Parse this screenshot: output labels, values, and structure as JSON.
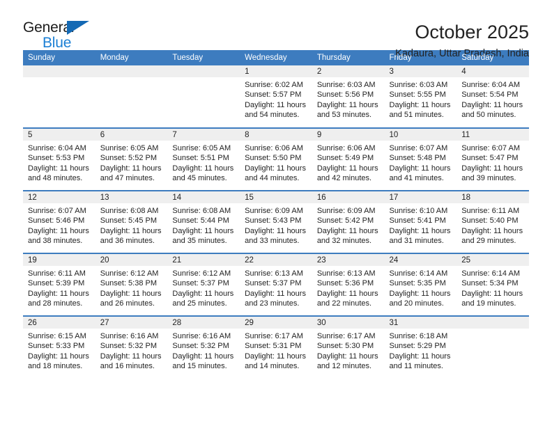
{
  "logo": {
    "word_one": "General",
    "word_two": "Blue",
    "triangle": "blue-triangle",
    "accent_dark": "#1469b4",
    "accent_light": "#1b7fd4"
  },
  "header": {
    "month_title": "October 2025",
    "location": "Kadaura, Uttar Pradesh, India"
  },
  "theme": {
    "header_blue": "#3d7cbf",
    "daynum_gray": "#efefef",
    "text": "#222222"
  },
  "calendar": {
    "weekday_headers": [
      "Sunday",
      "Monday",
      "Tuesday",
      "Wednesday",
      "Thursday",
      "Friday",
      "Saturday"
    ],
    "weeks": [
      [
        {
          "day": "",
          "empty": true
        },
        {
          "day": "",
          "empty": true
        },
        {
          "day": "",
          "empty": true
        },
        {
          "day": "1",
          "sunrise": "Sunrise: 6:02 AM",
          "sunset": "Sunset: 5:57 PM",
          "daylight_line1": "Daylight: 11 hours",
          "daylight_line2": "and 54 minutes."
        },
        {
          "day": "2",
          "sunrise": "Sunrise: 6:03 AM",
          "sunset": "Sunset: 5:56 PM",
          "daylight_line1": "Daylight: 11 hours",
          "daylight_line2": "and 53 minutes."
        },
        {
          "day": "3",
          "sunrise": "Sunrise: 6:03 AM",
          "sunset": "Sunset: 5:55 PM",
          "daylight_line1": "Daylight: 11 hours",
          "daylight_line2": "and 51 minutes."
        },
        {
          "day": "4",
          "sunrise": "Sunrise: 6:04 AM",
          "sunset": "Sunset: 5:54 PM",
          "daylight_line1": "Daylight: 11 hours",
          "daylight_line2": "and 50 minutes."
        }
      ],
      [
        {
          "day": "5",
          "sunrise": "Sunrise: 6:04 AM",
          "sunset": "Sunset: 5:53 PM",
          "daylight_line1": "Daylight: 11 hours",
          "daylight_line2": "and 48 minutes."
        },
        {
          "day": "6",
          "sunrise": "Sunrise: 6:05 AM",
          "sunset": "Sunset: 5:52 PM",
          "daylight_line1": "Daylight: 11 hours",
          "daylight_line2": "and 47 minutes."
        },
        {
          "day": "7",
          "sunrise": "Sunrise: 6:05 AM",
          "sunset": "Sunset: 5:51 PM",
          "daylight_line1": "Daylight: 11 hours",
          "daylight_line2": "and 45 minutes."
        },
        {
          "day": "8",
          "sunrise": "Sunrise: 6:06 AM",
          "sunset": "Sunset: 5:50 PM",
          "daylight_line1": "Daylight: 11 hours",
          "daylight_line2": "and 44 minutes."
        },
        {
          "day": "9",
          "sunrise": "Sunrise: 6:06 AM",
          "sunset": "Sunset: 5:49 PM",
          "daylight_line1": "Daylight: 11 hours",
          "daylight_line2": "and 42 minutes."
        },
        {
          "day": "10",
          "sunrise": "Sunrise: 6:07 AM",
          "sunset": "Sunset: 5:48 PM",
          "daylight_line1": "Daylight: 11 hours",
          "daylight_line2": "and 41 minutes."
        },
        {
          "day": "11",
          "sunrise": "Sunrise: 6:07 AM",
          "sunset": "Sunset: 5:47 PM",
          "daylight_line1": "Daylight: 11 hours",
          "daylight_line2": "and 39 minutes."
        }
      ],
      [
        {
          "day": "12",
          "sunrise": "Sunrise: 6:07 AM",
          "sunset": "Sunset: 5:46 PM",
          "daylight_line1": "Daylight: 11 hours",
          "daylight_line2": "and 38 minutes."
        },
        {
          "day": "13",
          "sunrise": "Sunrise: 6:08 AM",
          "sunset": "Sunset: 5:45 PM",
          "daylight_line1": "Daylight: 11 hours",
          "daylight_line2": "and 36 minutes."
        },
        {
          "day": "14",
          "sunrise": "Sunrise: 6:08 AM",
          "sunset": "Sunset: 5:44 PM",
          "daylight_line1": "Daylight: 11 hours",
          "daylight_line2": "and 35 minutes."
        },
        {
          "day": "15",
          "sunrise": "Sunrise: 6:09 AM",
          "sunset": "Sunset: 5:43 PM",
          "daylight_line1": "Daylight: 11 hours",
          "daylight_line2": "and 33 minutes."
        },
        {
          "day": "16",
          "sunrise": "Sunrise: 6:09 AM",
          "sunset": "Sunset: 5:42 PM",
          "daylight_line1": "Daylight: 11 hours",
          "daylight_line2": "and 32 minutes."
        },
        {
          "day": "17",
          "sunrise": "Sunrise: 6:10 AM",
          "sunset": "Sunset: 5:41 PM",
          "daylight_line1": "Daylight: 11 hours",
          "daylight_line2": "and 31 minutes."
        },
        {
          "day": "18",
          "sunrise": "Sunrise: 6:11 AM",
          "sunset": "Sunset: 5:40 PM",
          "daylight_line1": "Daylight: 11 hours",
          "daylight_line2": "and 29 minutes."
        }
      ],
      [
        {
          "day": "19",
          "sunrise": "Sunrise: 6:11 AM",
          "sunset": "Sunset: 5:39 PM",
          "daylight_line1": "Daylight: 11 hours",
          "daylight_line2": "and 28 minutes."
        },
        {
          "day": "20",
          "sunrise": "Sunrise: 6:12 AM",
          "sunset": "Sunset: 5:38 PM",
          "daylight_line1": "Daylight: 11 hours",
          "daylight_line2": "and 26 minutes."
        },
        {
          "day": "21",
          "sunrise": "Sunrise: 6:12 AM",
          "sunset": "Sunset: 5:37 PM",
          "daylight_line1": "Daylight: 11 hours",
          "daylight_line2": "and 25 minutes."
        },
        {
          "day": "22",
          "sunrise": "Sunrise: 6:13 AM",
          "sunset": "Sunset: 5:37 PM",
          "daylight_line1": "Daylight: 11 hours",
          "daylight_line2": "and 23 minutes."
        },
        {
          "day": "23",
          "sunrise": "Sunrise: 6:13 AM",
          "sunset": "Sunset: 5:36 PM",
          "daylight_line1": "Daylight: 11 hours",
          "daylight_line2": "and 22 minutes."
        },
        {
          "day": "24",
          "sunrise": "Sunrise: 6:14 AM",
          "sunset": "Sunset: 5:35 PM",
          "daylight_line1": "Daylight: 11 hours",
          "daylight_line2": "and 20 minutes."
        },
        {
          "day": "25",
          "sunrise": "Sunrise: 6:14 AM",
          "sunset": "Sunset: 5:34 PM",
          "daylight_line1": "Daylight: 11 hours",
          "daylight_line2": "and 19 minutes."
        }
      ],
      [
        {
          "day": "26",
          "sunrise": "Sunrise: 6:15 AM",
          "sunset": "Sunset: 5:33 PM",
          "daylight_line1": "Daylight: 11 hours",
          "daylight_line2": "and 18 minutes."
        },
        {
          "day": "27",
          "sunrise": "Sunrise: 6:16 AM",
          "sunset": "Sunset: 5:32 PM",
          "daylight_line1": "Daylight: 11 hours",
          "daylight_line2": "and 16 minutes."
        },
        {
          "day": "28",
          "sunrise": "Sunrise: 6:16 AM",
          "sunset": "Sunset: 5:32 PM",
          "daylight_line1": "Daylight: 11 hours",
          "daylight_line2": "and 15 minutes."
        },
        {
          "day": "29",
          "sunrise": "Sunrise: 6:17 AM",
          "sunset": "Sunset: 5:31 PM",
          "daylight_line1": "Daylight: 11 hours",
          "daylight_line2": "and 14 minutes."
        },
        {
          "day": "30",
          "sunrise": "Sunrise: 6:17 AM",
          "sunset": "Sunset: 5:30 PM",
          "daylight_line1": "Daylight: 11 hours",
          "daylight_line2": "and 12 minutes."
        },
        {
          "day": "31",
          "sunrise": "Sunrise: 6:18 AM",
          "sunset": "Sunset: 5:29 PM",
          "daylight_line1": "Daylight: 11 hours",
          "daylight_line2": "and 11 minutes."
        },
        {
          "day": "",
          "empty": true
        }
      ]
    ]
  }
}
